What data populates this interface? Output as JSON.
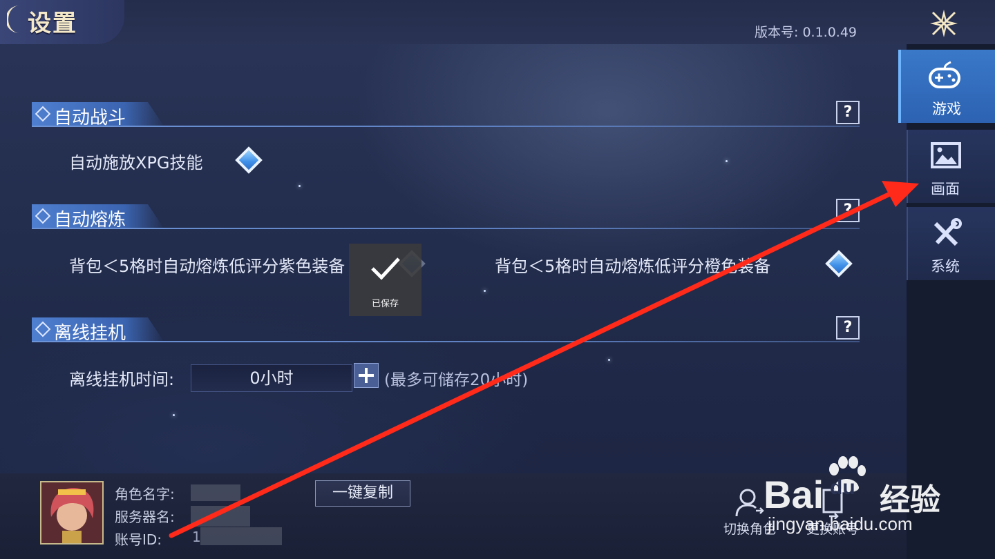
{
  "header": {
    "title": "设置",
    "version_text": "版本号: 0.1.0.49"
  },
  "tabs": [
    {
      "label": "游戏",
      "icon": "gamepad-icon",
      "active": true
    },
    {
      "label": "画面",
      "icon": "picture-icon",
      "active": false
    },
    {
      "label": "系统",
      "icon": "wrench-screwdriver-icon",
      "active": false
    }
  ],
  "sections": {
    "auto_battle": {
      "title": "自动战斗",
      "help": "?",
      "option_label": "自动施放XPG技能"
    },
    "auto_smelt": {
      "title": "自动熔炼",
      "help": "?",
      "option_purple": "背包＜5格时自动熔炼低评分紫色装备",
      "option_orange": "背包＜5格时自动熔炼低评分橙色装备"
    },
    "offline": {
      "title": "离线挂机",
      "help": "?",
      "time_label": "离线挂机时间:",
      "time_value": "0小时",
      "note": "(最多可储存20小时)"
    }
  },
  "toast": {
    "text": "已保存",
    "icon": "checkmark-icon"
  },
  "footer": {
    "role_name_label": "角色名字:",
    "server_name_label": "服务器名:",
    "account_id_label": "账号ID:",
    "account_id_prefix": "1",
    "copy_button": "一键复制",
    "switch_role": "切换角色",
    "switch_account": "更换账号"
  },
  "watermark": {
    "brand_en": "Bai",
    "brand_du": "du",
    "brand_cn": "经验",
    "url": "jingyan.baidu.com"
  },
  "colors": {
    "accent_blue": "#3a78c8",
    "annotation_red": "#ff2a1a",
    "toggle_blue": "#3e8ee8"
  }
}
